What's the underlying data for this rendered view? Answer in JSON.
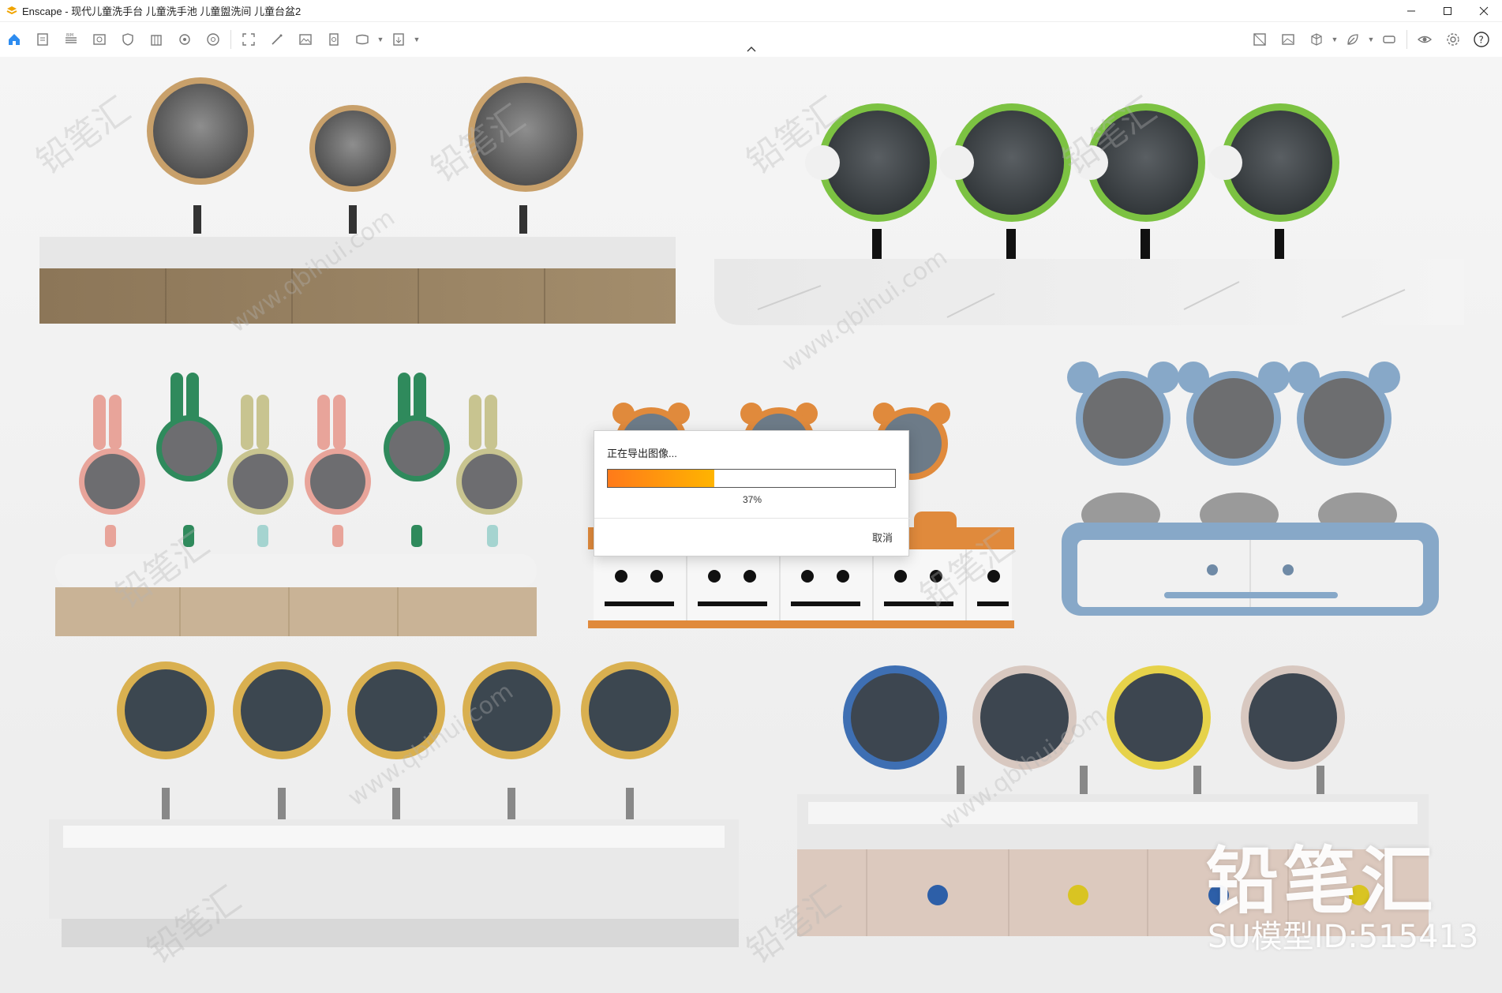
{
  "window": {
    "title": "Enscape - 现代儿童洗手台 儿童洗手池 儿童盥洗间 儿童台盆2",
    "controls": [
      "minimize",
      "maximize",
      "close"
    ]
  },
  "toolbar": {
    "left_icons": [
      "home-icon",
      "document-icon",
      "bim-icon",
      "view-icon",
      "shield-icon",
      "building-icon",
      "camera-map-icon",
      "settings-wheel-icon",
      "screenshot-icon",
      "wand-icon",
      "image-icon",
      "batch-export-icon",
      "panorama-icon",
      "export-icon"
    ],
    "right_icons": [
      "asset-library-icon",
      "render-icon",
      "cube-icon",
      "leaf-icon",
      "vr-headset-icon",
      "eye-icon",
      "gear-icon",
      "help-icon"
    ]
  },
  "dialog": {
    "title": "正在导出图像...",
    "progress_percent": 37,
    "progress_label": "37%",
    "cancel_label": "取消"
  },
  "watermark": {
    "brand": "铅笔汇",
    "model_id": "SU模型ID:515413",
    "diagonal_text_1": "铅笔汇",
    "diagonal_text_2": "www.qbihui.com"
  },
  "colors": {
    "accent": "#2d8cf0",
    "progress_start": "#ff7a1a",
    "progress_end": "#ffb400"
  }
}
